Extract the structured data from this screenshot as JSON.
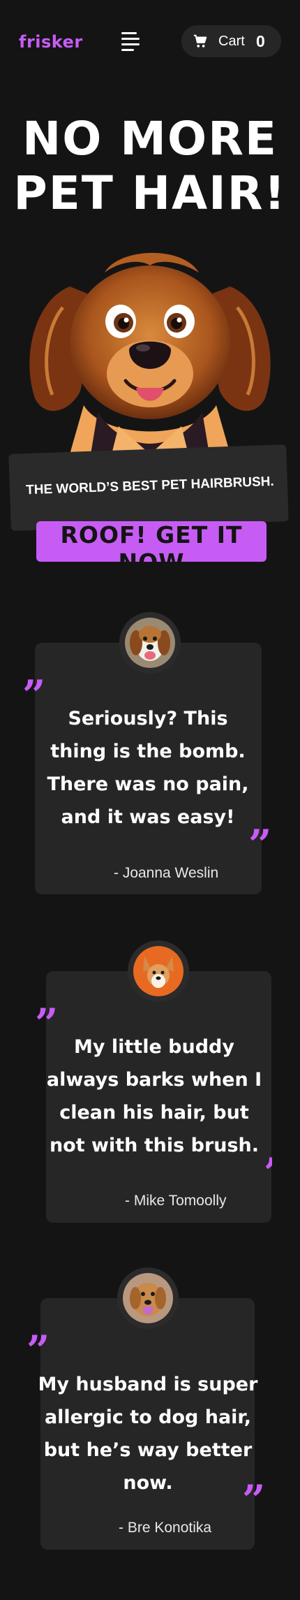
{
  "brand": {
    "logo": "frisker",
    "accent": "#c75cf5",
    "background": "#141414",
    "card": "#262626"
  },
  "nav": {
    "menu_icon": "hamburger-menu-icon",
    "cart": {
      "icon": "shopping-cart-icon",
      "label": "Cart",
      "count": "0"
    }
  },
  "hero": {
    "title_line1": "NO MORE",
    "title_line2": "PET HAIR!",
    "image": "cartoon-spaniel-dog",
    "tagline": "THE WORLD’S BEST PET HAIRBRUSH.",
    "cta_label": "ROOF! GET IT NOW"
  },
  "testimonials": [
    {
      "avatar": "beagle-photo",
      "quote": "Seriously? This thing is the bomb. There was no pain, and it was easy!",
      "author": "- Joanna Weslin"
    },
    {
      "avatar": "corgi-photo",
      "quote": "My little buddy always barks when I clean his hair, but not with this brush.",
      "author": "- Mike Tomoolly"
    },
    {
      "avatar": "golden-retriever-photo",
      "quote": "My husband is super allergic to dog hair, but he’s way better now.",
      "author": "- Bre Konotika"
    }
  ],
  "quote_glyph": "”"
}
